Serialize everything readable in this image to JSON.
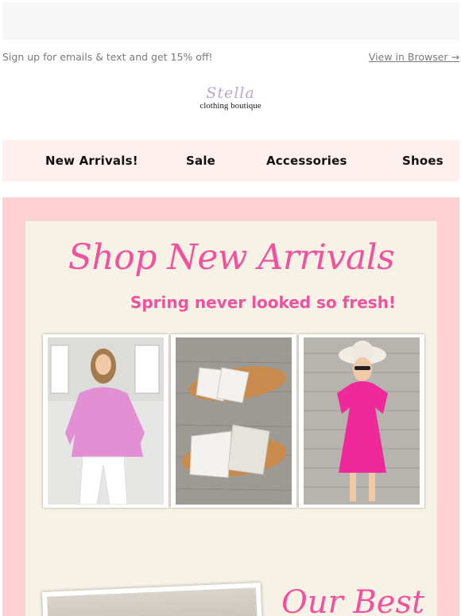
{
  "header": {
    "promo_text": "Sign up for emails & text and get 15% off!",
    "view_browser": "View in Browser →"
  },
  "logo": {
    "script_text": "Stella",
    "subtitle": "clothing boutique"
  },
  "nav": {
    "items": [
      {
        "label": "New Arrivals!"
      },
      {
        "label": "Sale"
      },
      {
        "label": "Accessories"
      },
      {
        "label": "Shoes"
      }
    ]
  },
  "hero": {
    "heading": "Shop New Arrivals",
    "subheading": "Spring never looked so fresh!",
    "photos": [
      {
        "icon": "pink-blouse-photo"
      },
      {
        "icon": "white-sandals-photo"
      },
      {
        "icon": "pink-dress-photo"
      }
    ],
    "section_title": "Our Best"
  },
  "colors": {
    "accent_pink": "#f0529f",
    "frame_pink": "#fdd1d1",
    "cream": "#f7f2e6",
    "nav_bg": "#fdf0ef",
    "logo_lavender": "#b9a5dd"
  }
}
